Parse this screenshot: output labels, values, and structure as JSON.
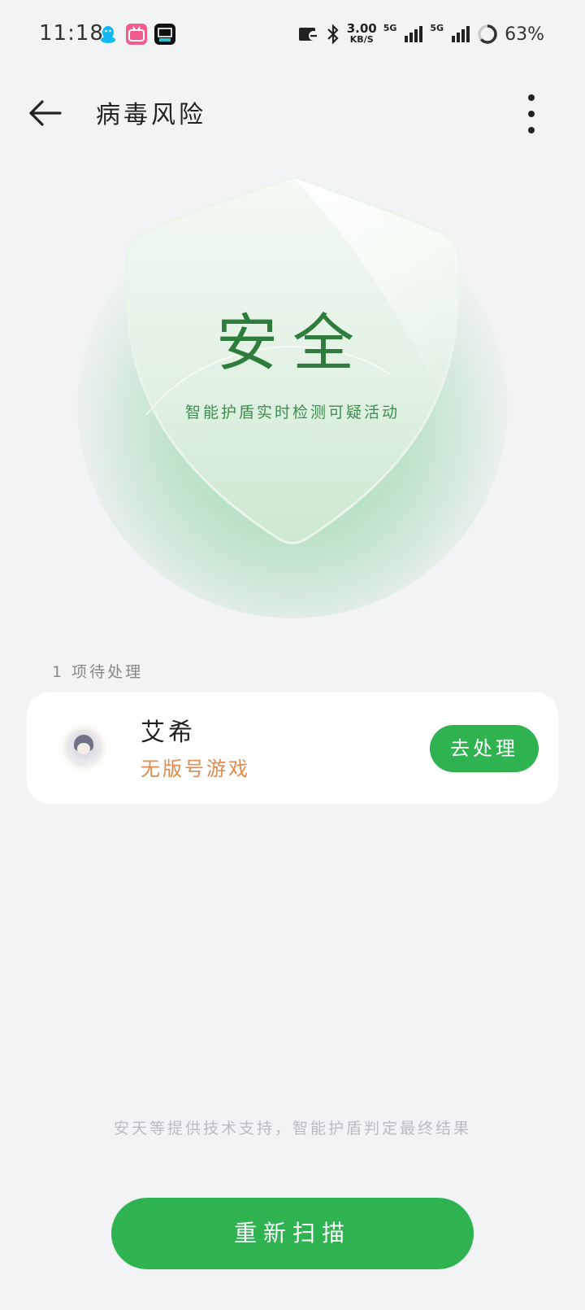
{
  "status_bar": {
    "time": "11:18",
    "net_speed_value": "3.00",
    "net_speed_unit": "KB/S",
    "sim1_label": "5G",
    "sim2_label": "5G",
    "battery_percent": "63%",
    "apps": [
      "qq-icon",
      "bilibili-icon",
      "dewu-icon"
    ]
  },
  "header": {
    "title": "病毒风险"
  },
  "shield": {
    "status": "安全",
    "caption": "智能护盾实时检测可疑活动",
    "color_accent": "#2fb351"
  },
  "pending": {
    "count_label": "1 项待处理",
    "items": [
      {
        "name": "艾希",
        "risk": "无版号游戏",
        "action_label": "去处理"
      }
    ]
  },
  "footer": {
    "note": "安天等提供技术支持，智能护盾判定最终结果",
    "rescan_label": "重新扫描"
  },
  "colors": {
    "background": "#f2f3f5",
    "primary_green": "#2fb351",
    "risk_orange": "#e08a4f"
  }
}
